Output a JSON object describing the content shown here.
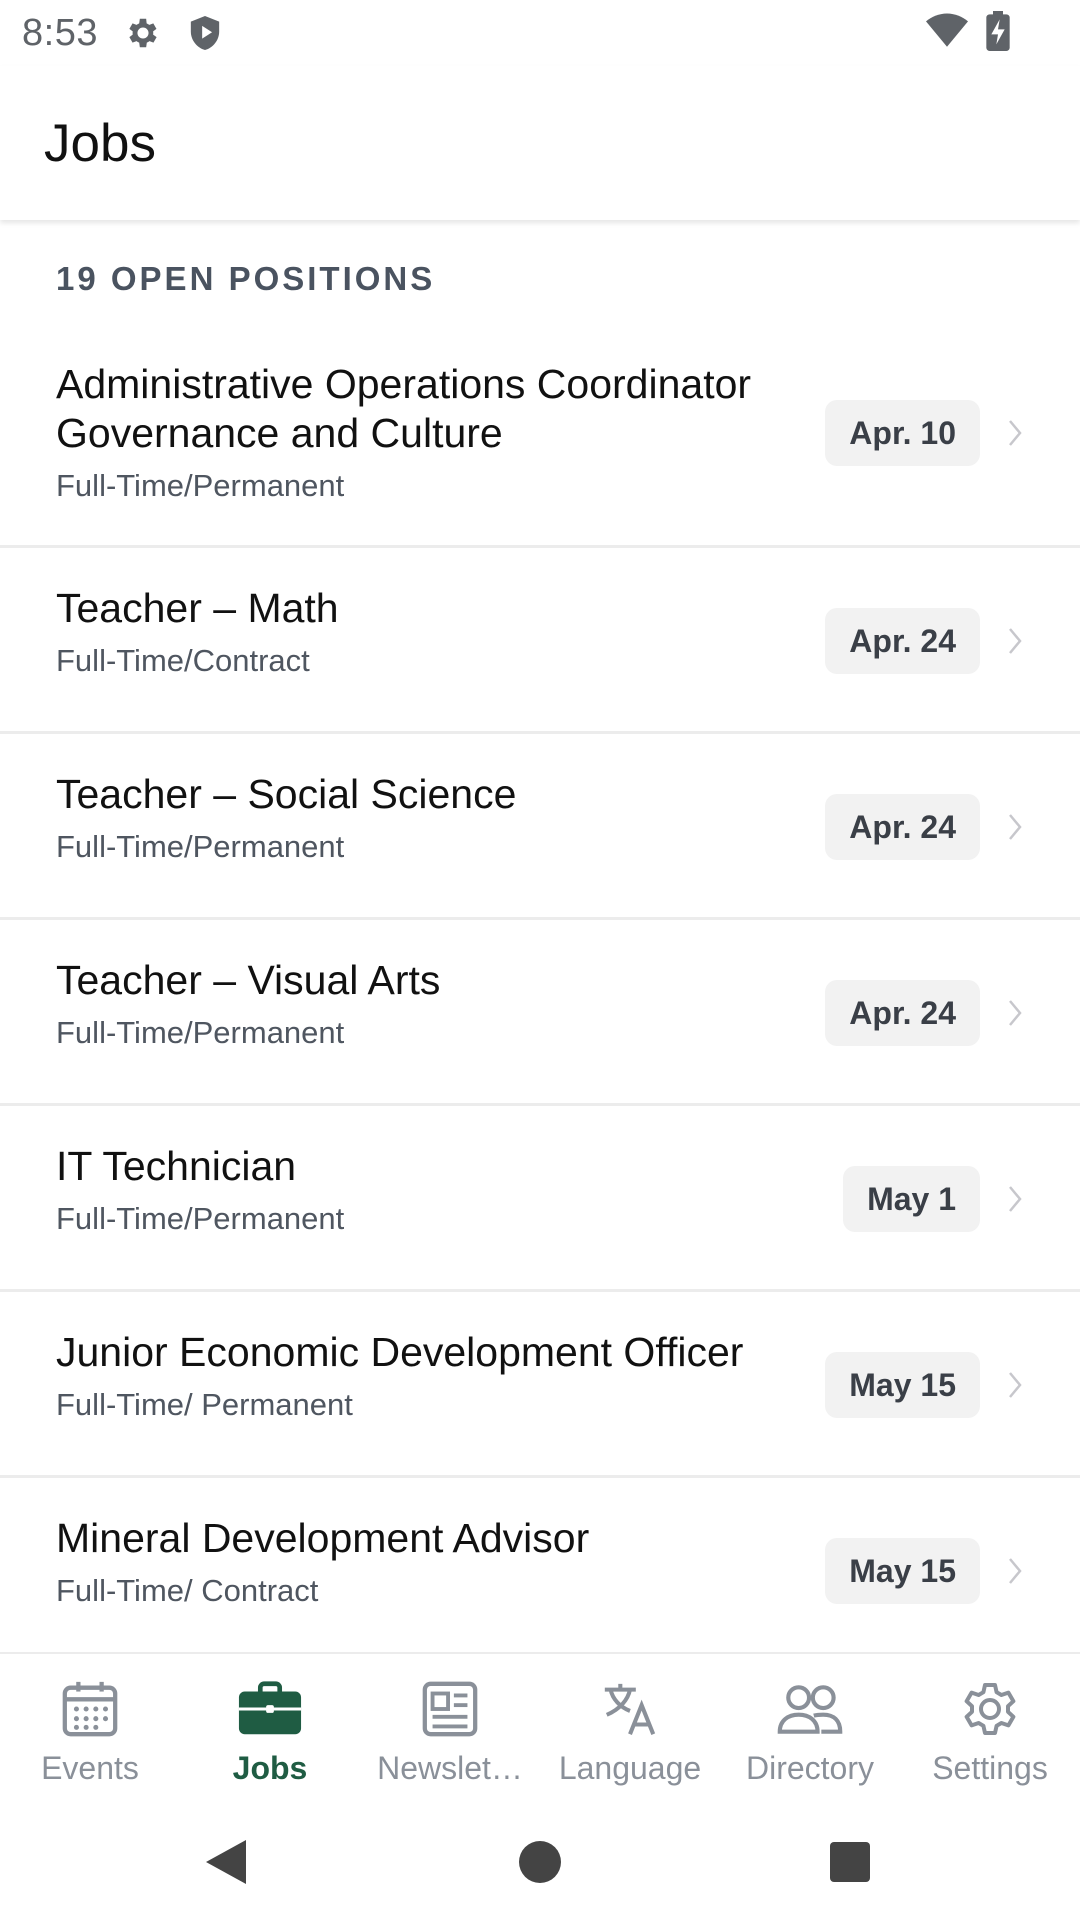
{
  "status_bar": {
    "time": "8:53",
    "icons": [
      "gear-icon",
      "shield-icon",
      "wifi-icon",
      "battery-charging-icon"
    ]
  },
  "header": {
    "title": "Jobs"
  },
  "list": {
    "section_header": "19 OPEN POSITIONS",
    "jobs": [
      {
        "title": "Administrative Operations Coordinator Governance and Culture",
        "type": "Full-Time/Permanent",
        "date": "Apr. 10"
      },
      {
        "title": "Teacher – Math",
        "type": "Full-Time/Contract",
        "date": "Apr. 24"
      },
      {
        "title": "Teacher – Social Science",
        "type": "Full-Time/Permanent",
        "date": "Apr. 24"
      },
      {
        "title": "Teacher – Visual Arts",
        "type": "Full-Time/Permanent",
        "date": "Apr. 24"
      },
      {
        "title": "IT Technician",
        "type": "Full-Time/Permanent",
        "date": "May 1"
      },
      {
        "title": "Junior Economic Development Officer",
        "type": "Full-Time/ Permanent",
        "date": "May 15"
      },
      {
        "title": "Mineral Development Advisor",
        "type": "Full-Time/ Contract",
        "date": "May 15"
      }
    ]
  },
  "bottom_nav": {
    "items": [
      {
        "label": "Events",
        "icon": "calendar-icon",
        "active": false
      },
      {
        "label": "Jobs",
        "icon": "briefcase-icon",
        "active": true
      },
      {
        "label": "Newslet…",
        "icon": "newspaper-icon",
        "active": false
      },
      {
        "label": "Language",
        "icon": "translate-icon",
        "active": false
      },
      {
        "label": "Directory",
        "icon": "people-icon",
        "active": false
      },
      {
        "label": "Settings",
        "icon": "gear-icon",
        "active": false
      }
    ]
  },
  "colors": {
    "accent": "#1f5c43",
    "inactive": "#8a9099",
    "badge_bg": "#f2f2f2"
  }
}
